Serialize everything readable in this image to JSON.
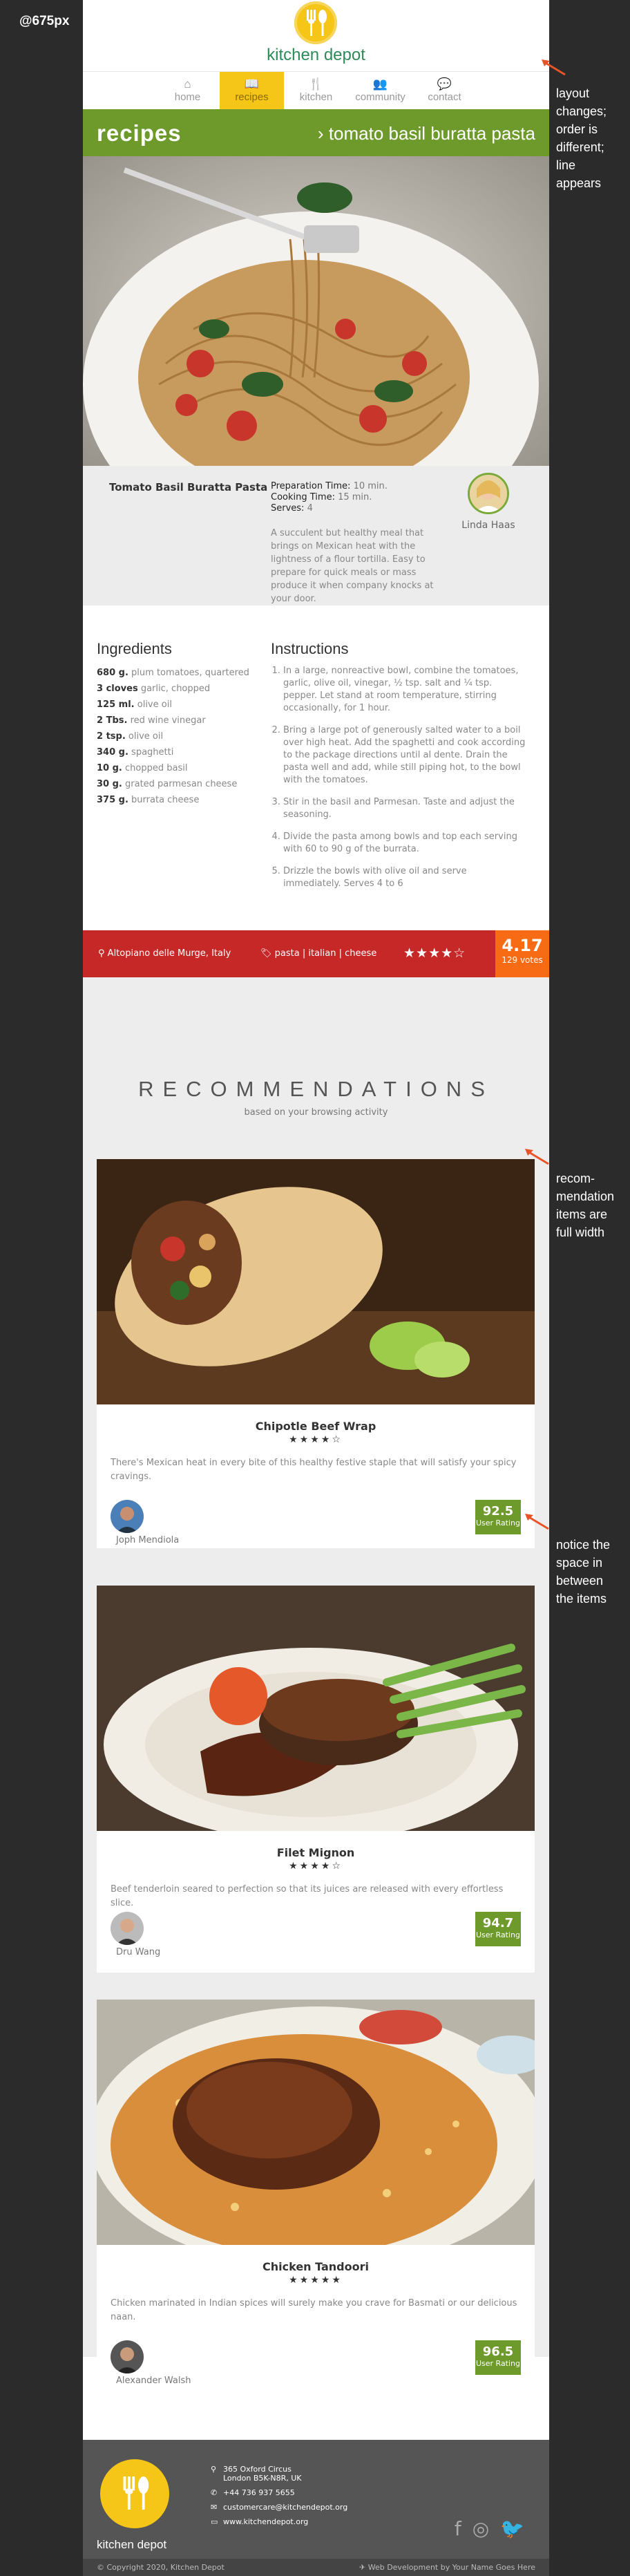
{
  "breakpoint_label": "@675px",
  "header": {
    "brand": "kitchen depot"
  },
  "nav": [
    {
      "label": "home",
      "icon": "home-icon",
      "glyph": "⌂",
      "active": false
    },
    {
      "label": "recipes",
      "icon": "book-icon",
      "glyph": "📖",
      "active": true
    },
    {
      "label": "kitchen",
      "icon": "utensils-icon",
      "glyph": "🍴",
      "active": false
    },
    {
      "label": "community",
      "icon": "users-icon",
      "glyph": "👥",
      "active": false
    },
    {
      "label": "contact",
      "icon": "chat-icon",
      "glyph": "💬",
      "active": false
    }
  ],
  "titlebar": {
    "section": "recipes",
    "crumb_arrow": "›",
    "crumb": "tomato basil buratta pasta"
  },
  "info": {
    "recipe_name": "Tomato Basil Buratta Pasta",
    "prep_label": "Preparation Time:",
    "prep_value": "10 min.",
    "cook_label": "Cooking Time:",
    "cook_value": "15 min.",
    "serves_label": "Serves:",
    "serves_value": "4",
    "description": "A succulent but healthy meal that brings on Mexican heat with the lightness of a flour tortilla. Easy to prepare for quick meals or mass produce it when company knocks at your door.",
    "author": "Linda Haas"
  },
  "ingredients": {
    "heading": "Ingredients",
    "items": [
      {
        "qty": "680 g.",
        "name": "plum tomatoes, quartered"
      },
      {
        "qty": "3 cloves",
        "name": "garlic, chopped"
      },
      {
        "qty": "125 ml.",
        "name": "olive oil"
      },
      {
        "qty": "2 Tbs.",
        "name": "red wine vinegar"
      },
      {
        "qty": "2 tsp.",
        "name": "olive oil"
      },
      {
        "qty": "340 g.",
        "name": "spaghetti"
      },
      {
        "qty": "10 g.",
        "name": "chopped basil"
      },
      {
        "qty": "30 g.",
        "name": "grated parmesan cheese"
      },
      {
        "qty": "375 g.",
        "name": "burrata cheese"
      }
    ]
  },
  "instructions": {
    "heading": "Instructions",
    "steps": [
      "In a large, nonreactive bowl, combine the tomatoes, garlic, olive oil, vinegar, ½ tsp. salt and ¼ tsp. pepper. Let stand at room temperature, stirring occasionally, for 1 hour.",
      "Bring a large pot of generously salted water to a boil over high heat. Add the spaghetti and cook according to the package directions until al dente. Drain the pasta well and add, while still piping hot, to the bowl with the tomatoes.",
      "Stir in the basil and Parmesan. Taste and adjust the seasoning.",
      "Divide the pasta among bowls and top each serving with 60 to 90 g of the burrata.",
      "Drizzle the bowls with olive oil and serve immediately. Serves 4 to 6"
    ]
  },
  "redbar": {
    "location": "Altopiano delle Murge, Italy",
    "tags": "pasta | italian | cheese",
    "stars": "★★★★☆",
    "rating": "4.17",
    "votes": "129 votes"
  },
  "recommendations": {
    "title": "RECOMMENDATIONS",
    "subtitle": "based on your browsing activity",
    "items": [
      {
        "name": "Chipotle Beef Wrap",
        "stars": "★★★★☆",
        "description": "There's Mexican heat in every bite of this healthy festive staple that will satisfy your spicy cravings.",
        "author": "Joph Mendiola",
        "rating": "92.5",
        "rating_label": "User Rating"
      },
      {
        "name": "Filet Mignon",
        "stars": "★★★★☆",
        "description": "Beef tenderloin seared to perfection so that its juices are released with every effortless slice.",
        "author": "Dru Wang",
        "rating": "94.7",
        "rating_label": "User Rating"
      },
      {
        "name": "Chicken Tandoori",
        "stars": "★★★★★",
        "description": "Chicken marinated in Indian spices will surely make you crave for Basmati or our delicious naan.",
        "author": "Alexander Walsh",
        "rating": "96.5",
        "rating_label": "User Rating"
      }
    ]
  },
  "footer": {
    "brand": "kitchen depot",
    "address_line1": "365 Oxford Circus",
    "address_line2": "London B5K-N8R, UK",
    "phone": "+44 736 937 5655",
    "email": "customercare@kitchendepot.org",
    "website": "www.kitchendepot.org",
    "copyright": "© Copyright 2020, Kitchen Depot",
    "credit": "Web Development by Your Name Goes Here"
  },
  "annotations": {
    "note1": [
      "layout",
      "changes;",
      "order is",
      "different;",
      "line",
      "appears"
    ],
    "note2": [
      "recom-",
      "mendation",
      "items are",
      "full width"
    ],
    "note3": [
      "notice the",
      "space in",
      "between",
      "the items"
    ]
  },
  "colors": {
    "green": "#6e9a2c",
    "yellow": "#f5c518",
    "red": "#c62828",
    "orange": "#f76b14"
  }
}
